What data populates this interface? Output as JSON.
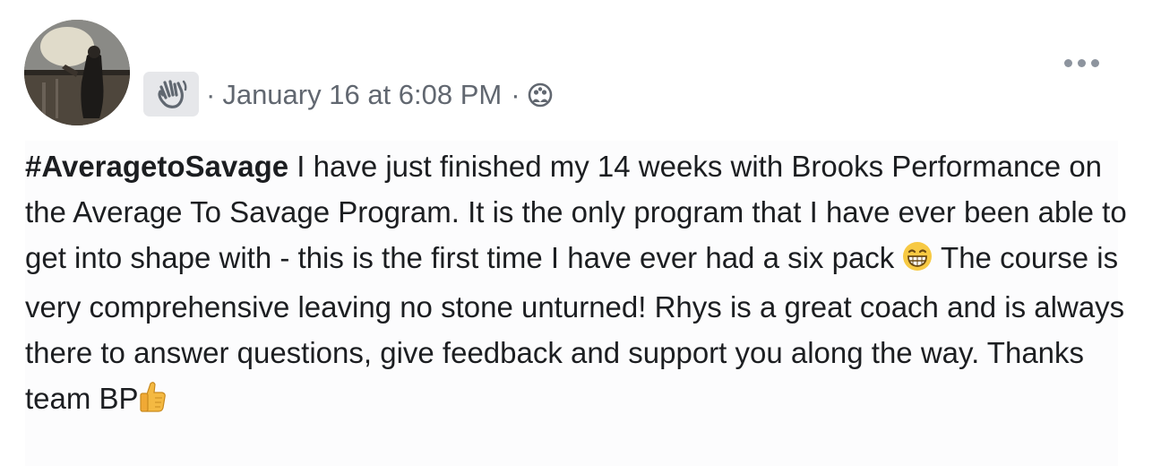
{
  "post": {
    "avatar_icon": "profile-photo",
    "reaction_icon": "waving-hand-icon",
    "separator": "·",
    "timestamp": "January 16 at 6:08 PM",
    "privacy_icon": "friends-globe-icon",
    "more_icon": "more-options-icon",
    "hashtag": "#AveragetoSavage",
    "body_part1": " I have just finished my 14 weeks with Brooks Performance on the Average To Savage Program. It is the only program that I have ever been able to get into shape with - this is the first time I have ever had a six pack ",
    "emoji_grin": "grinning-face-icon",
    "body_part2": " The course is very comprehensive leaving no stone unturned! Rhys is a great coach and is always there to answer questions, give feedback and support you along the way. Thanks team BP",
    "emoji_thumbs": "thumbs-up-icon"
  }
}
